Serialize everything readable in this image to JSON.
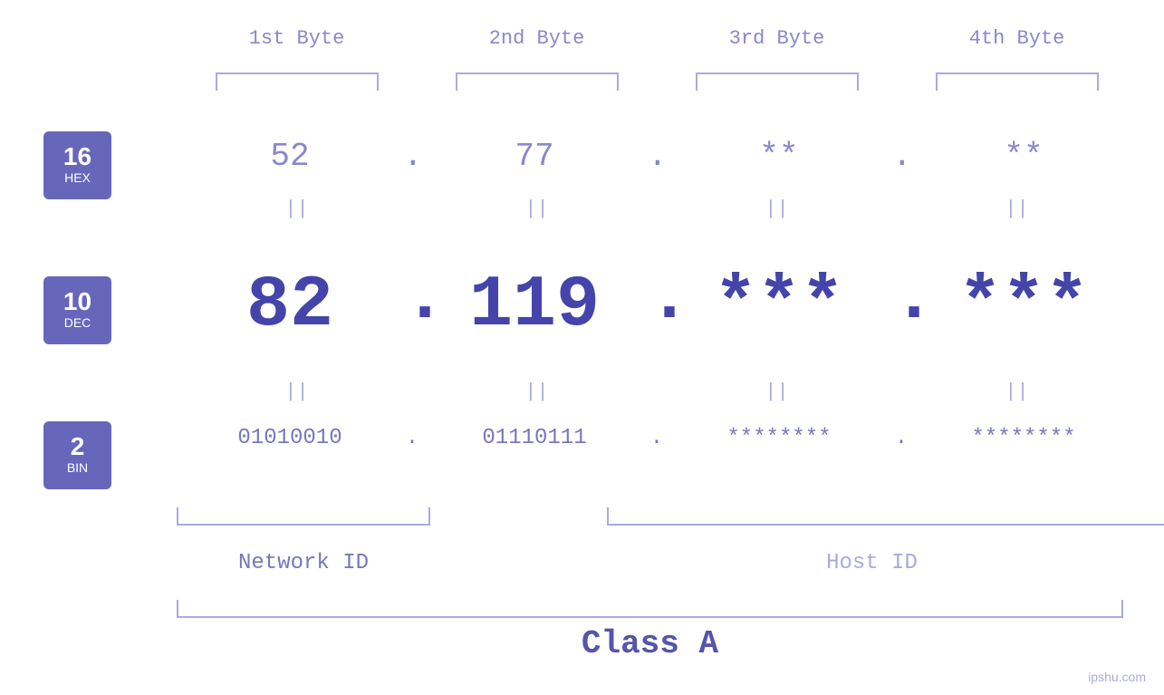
{
  "headers": {
    "byte1": "1st Byte",
    "byte2": "2nd Byte",
    "byte3": "3rd Byte",
    "byte4": "4th Byte"
  },
  "bases": {
    "hex": {
      "num": "16",
      "name": "HEX"
    },
    "dec": {
      "num": "10",
      "name": "DEC"
    },
    "bin": {
      "num": "2",
      "name": "BIN"
    }
  },
  "hex_row": {
    "b1": "52",
    "b2": "77",
    "b3": "**",
    "b4": "**",
    "dot": "."
  },
  "dec_row": {
    "b1": "82",
    "b2": "119",
    "b3": "***",
    "b4": "***",
    "dot": "."
  },
  "bin_row": {
    "b1": "01010010",
    "b2": "01110111",
    "b3": "********",
    "b4": "********",
    "dot": "."
  },
  "labels": {
    "network_id": "Network ID",
    "host_id": "Host ID",
    "class": "Class A"
  },
  "watermark": "ipshu.com"
}
